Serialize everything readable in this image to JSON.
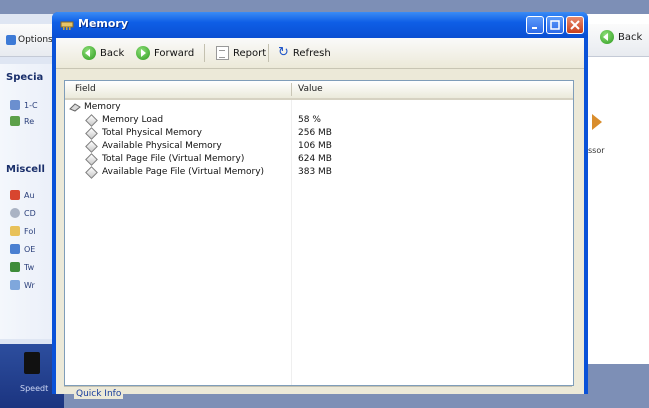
{
  "background_left": {
    "toolbar_label": "Options",
    "section_special": "Specia",
    "special_items": [
      "1-C",
      "Re"
    ],
    "section_misc": "Miscell",
    "misc_items": [
      "Au",
      "CD",
      "Fol",
      "OE",
      "Tw",
      "Wr"
    ],
    "taskbar_label": "Speedt"
  },
  "background_right": {
    "back_label": "Back",
    "processor_fragment": "ssor"
  },
  "window": {
    "title": "Memory",
    "toolbar": {
      "back": "Back",
      "forward": "Forward",
      "report": "Report",
      "refresh": "Refresh"
    },
    "columns": {
      "field": "Field",
      "value": "Value"
    },
    "category": "Memory",
    "rows": [
      {
        "field": "Memory Load",
        "value": "58 %"
      },
      {
        "field": "Total Physical Memory",
        "value": "256 MB"
      },
      {
        "field": "Available Physical Memory",
        "value": "106 MB"
      },
      {
        "field": "Total Page File (Virtual Memory)",
        "value": "624 MB"
      },
      {
        "field": "Available Page File (Virtual Memory)",
        "value": "383 MB"
      }
    ],
    "quick_info": "Quick Info"
  },
  "colors": {
    "titlebar": "#0a52d8",
    "client": "#ece9d8",
    "close_button": "#c8401e"
  }
}
